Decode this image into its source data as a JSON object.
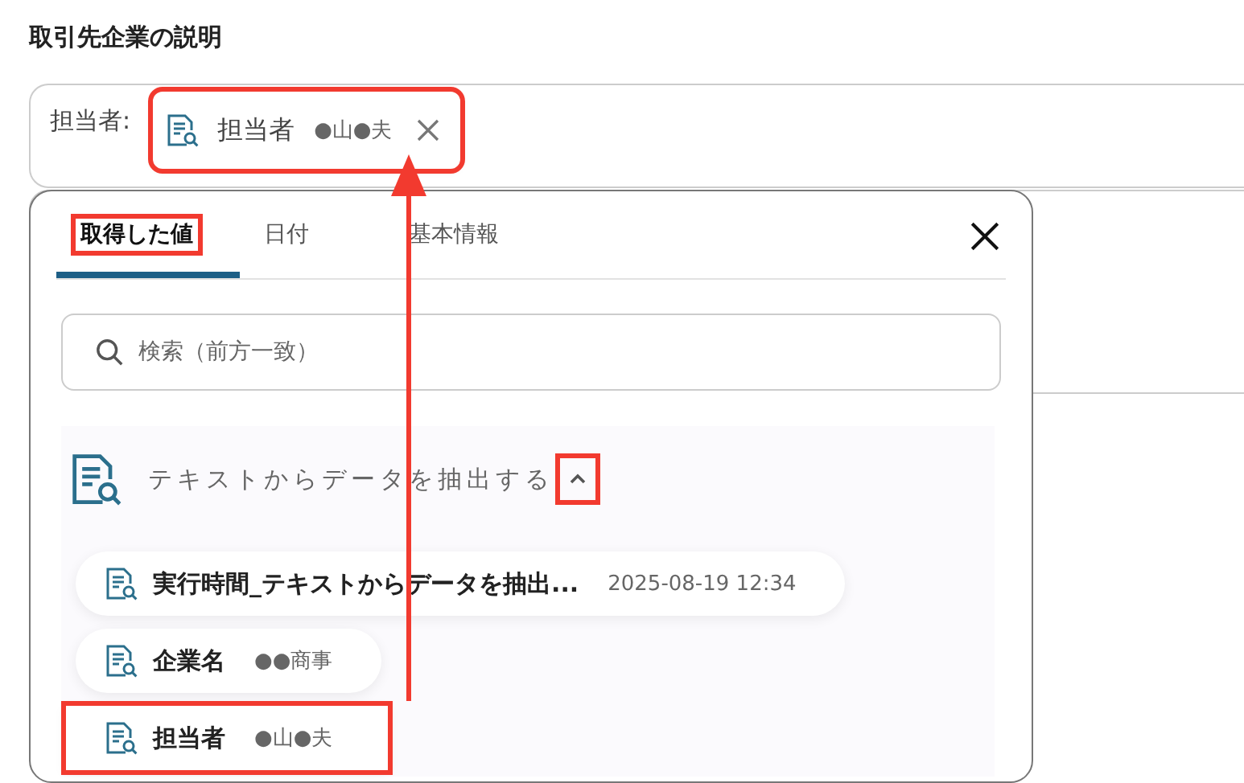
{
  "section_title": "取引先企業の説明",
  "field": {
    "label": "担当者:",
    "chip": {
      "name": "担当者",
      "value": "●山●夫",
      "highlighted": true
    }
  },
  "popup": {
    "tabs": [
      {
        "label": "取得した値",
        "selected": true,
        "highlighted": true
      },
      {
        "label": "日付",
        "selected": false,
        "highlighted": false
      },
      {
        "label": "基本情報",
        "selected": false,
        "highlighted": false
      }
    ],
    "search": {
      "placeholder": "検索（前方一致）"
    },
    "group": {
      "title": "テキストからデータを抽出する",
      "expanded": true,
      "toggle_highlighted": true,
      "items": [
        {
          "name": "実行時間_テキストからデータを抽出...",
          "value": "2025-08-19 12:34",
          "highlighted": false
        },
        {
          "name": "企業名",
          "value": "●●商事",
          "highlighted": false
        },
        {
          "name": "担当者",
          "value": "●山●夫",
          "highlighted": true
        }
      ]
    }
  },
  "annotation_arrow": {
    "shown": true
  }
}
